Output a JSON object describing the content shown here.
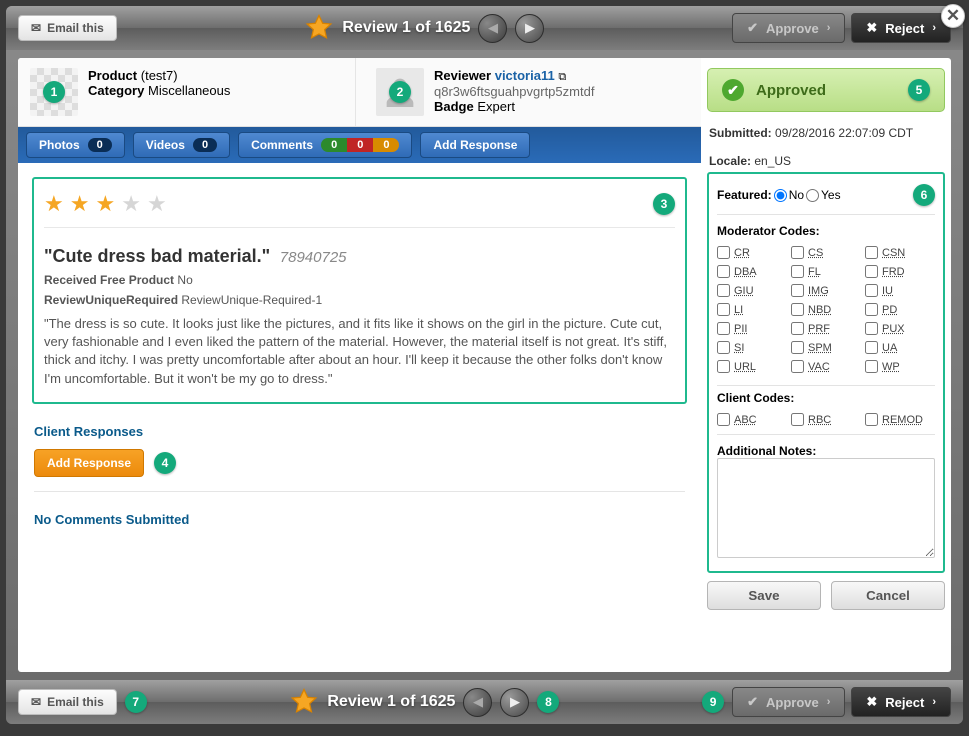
{
  "header": {
    "email_this": "Email this",
    "title": "Review 1 of 1625",
    "approve": "Approve",
    "reject": "Reject"
  },
  "product": {
    "label": "Product",
    "name": "(test7)",
    "category_label": "Category",
    "category": "Miscellaneous"
  },
  "reviewer": {
    "label": "Reviewer",
    "name": "victoria11",
    "id": "q8r3w6ftsguahpvgrtp5zmtdf",
    "badge_label": "Badge",
    "badge": "Expert"
  },
  "tabs": {
    "photos": "Photos",
    "photos_count": "0",
    "videos": "Videos",
    "videos_count": "0",
    "comments": "Comments",
    "comments_counts": [
      "0",
      "0",
      "0"
    ],
    "add_response": "Add Response"
  },
  "review": {
    "rating": 3,
    "title": "\"Cute dress bad material.\"",
    "number": "78940725",
    "free_label": "Received Free Product",
    "free_value": "No",
    "unique_label": "ReviewUniqueRequired",
    "unique_value": "ReviewUnique-Required-1",
    "body": "\"The dress is so cute. It looks just like the pictures, and it fits like it shows on the girl in the picture. Cute cut, very fashionable and I even liked the pattern of the material. However, the material itself is not great. It's stiff, thick and itchy. I was pretty uncomfortable after about an hour. I'll keep it because the other folks don't know I'm uncomfortable. But it won't be my go to dress.\""
  },
  "client_responses": {
    "heading": "Client Responses",
    "add": "Add Response",
    "no_comments": "No Comments Submitted"
  },
  "status": {
    "label": "Approved",
    "submitted_label": "Submitted:",
    "submitted_value": "09/28/2016 22:07:09 CDT",
    "locale_label": "Locale:",
    "locale_value": "en_US"
  },
  "panel": {
    "featured_label": "Featured:",
    "no": "No",
    "yes": "Yes",
    "mod_codes_label": "Moderator Codes:",
    "mod_codes": [
      "CR",
      "CS",
      "CSN",
      "DBA",
      "FL",
      "FRD",
      "GIU",
      "IMG",
      "IU",
      "LI",
      "NBD",
      "PD",
      "PII",
      "PRF",
      "PUX",
      "SI",
      "SPM",
      "UA",
      "URL",
      "VAC",
      "WP"
    ],
    "client_codes_label": "Client Codes:",
    "client_codes": [
      "ABC",
      "RBC",
      "REMOD"
    ],
    "notes_label": "Additional Notes:"
  },
  "buttons": {
    "save": "Save",
    "cancel": "Cancel"
  },
  "annotations": [
    "1",
    "2",
    "3",
    "4",
    "5",
    "6",
    "7",
    "8",
    "9"
  ]
}
